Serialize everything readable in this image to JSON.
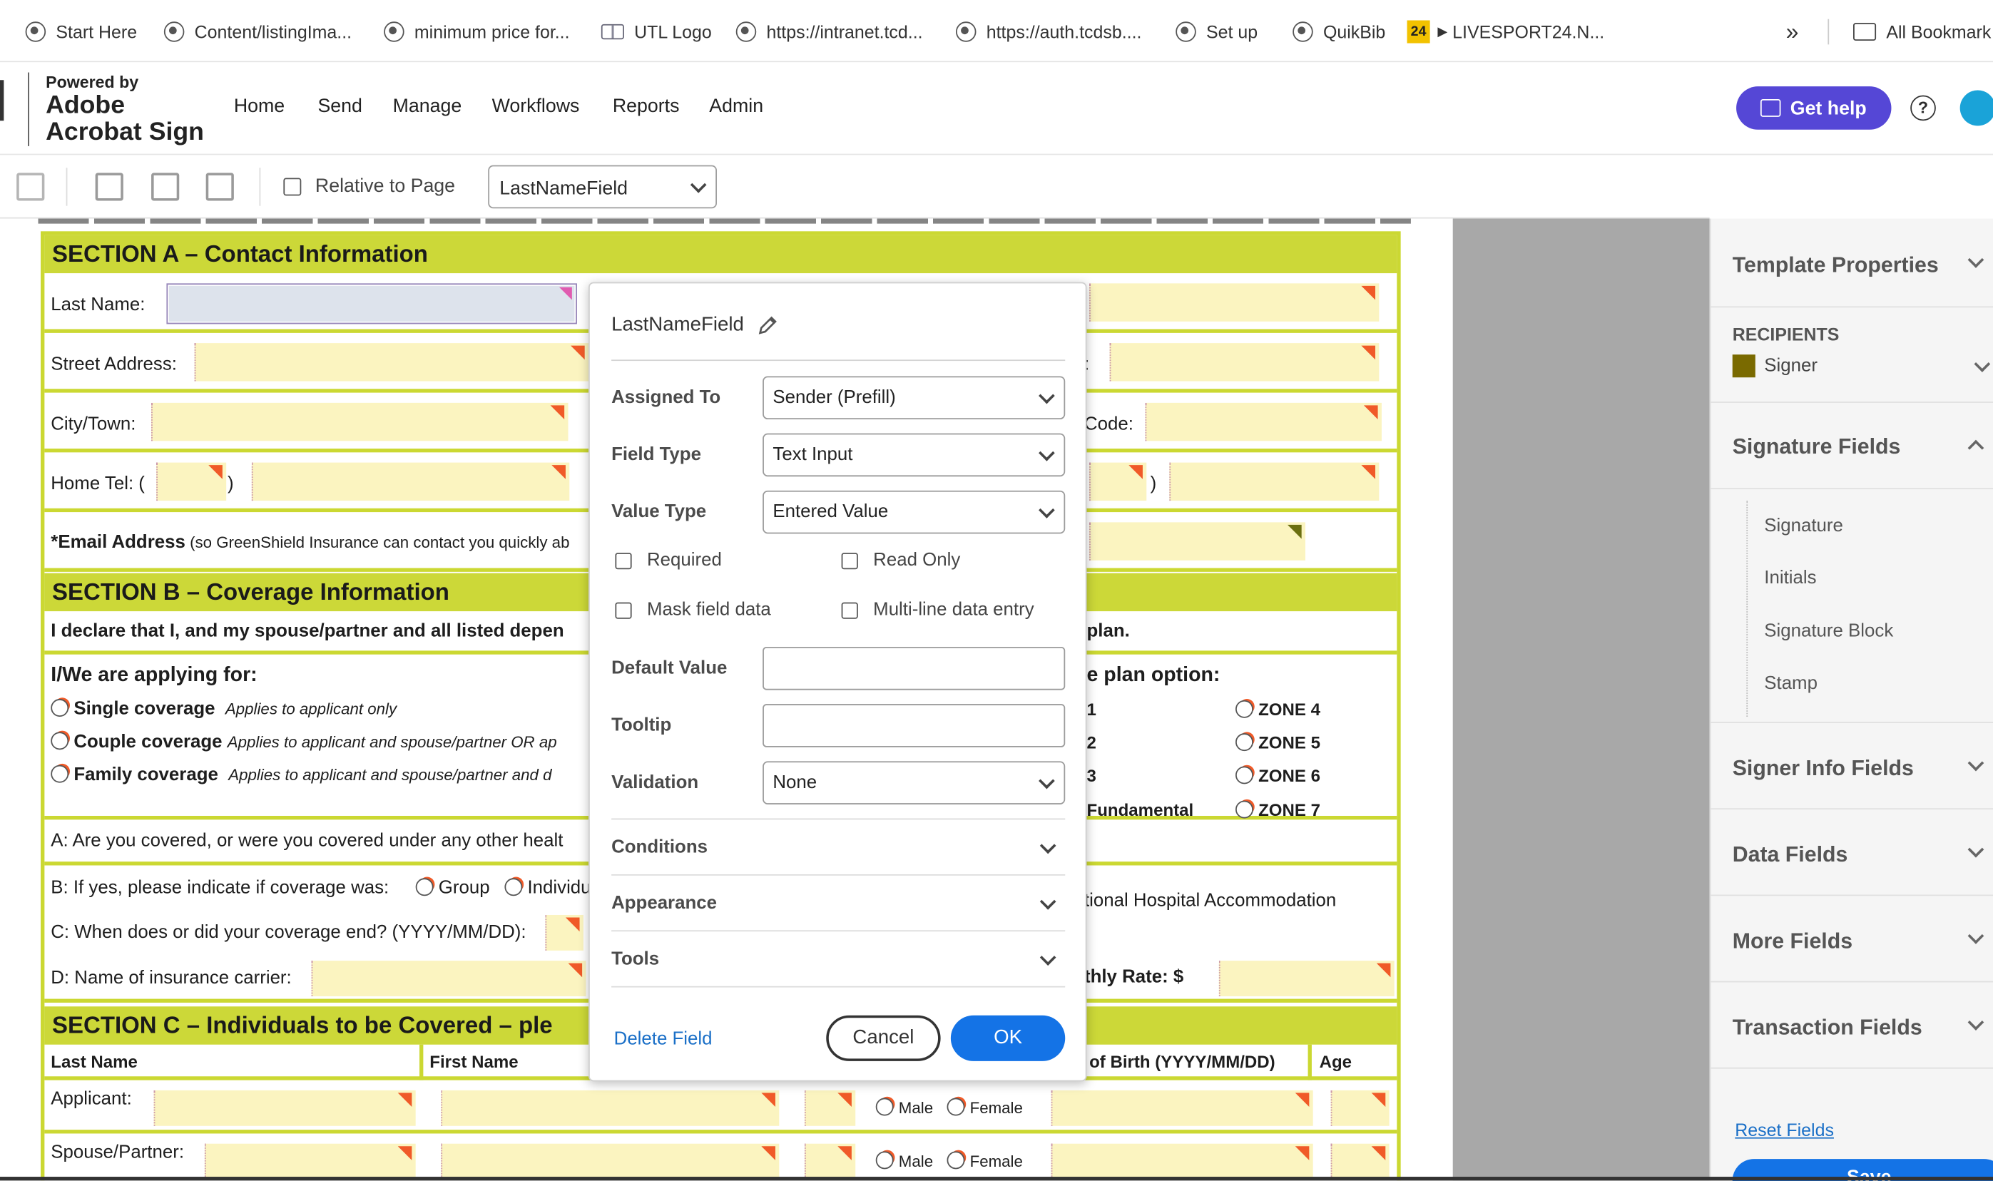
{
  "bookmarks": {
    "items": [
      {
        "label": "Start Here"
      },
      {
        "label": "Content/listingIma..."
      },
      {
        "label": "minimum price for..."
      },
      {
        "label": "UTL Logo"
      },
      {
        "label": "https://intranet.tcd..."
      },
      {
        "label": "https://auth.tcdsb...."
      },
      {
        "label": "Set up"
      },
      {
        "label": "QuikBib"
      },
      {
        "label": "LIVESPORT24.N..."
      }
    ],
    "livesport_badge": "24",
    "overflow": "»",
    "all_bookmarks": "All Bookmark"
  },
  "header": {
    "powered_by": "Powered by",
    "brand_line1": "Adobe",
    "brand_line2": "Acrobat Sign",
    "nav": [
      "Home",
      "Send",
      "Manage",
      "Workflows",
      "Reports",
      "Admin"
    ],
    "get_help": "Get help",
    "help_glyph": "?"
  },
  "toolbar": {
    "relative_to_page": "Relative to Page",
    "field_select": "LastNameField"
  },
  "form": {
    "section_a": "SECTION A – Contact Information",
    "last_name": "Last Name:",
    "street_address": "Street Address:",
    "city_town": "City/Town:",
    "home_tel": "Home Tel: (",
    "paren_close": ")",
    "email_label_bold": "*Email Address",
    "email_label_rest": " (so GreenShield Insurance can contact you quickly ab",
    "right_colon": ":",
    "right_code": "Code:",
    "right_paren": ")",
    "section_b": "SECTION B – Coverage Information",
    "declare": "I declare that I, and my spouse/partner and all listed depen",
    "declare_right": "plan.",
    "applying": "I/We are applying for:",
    "plan_option": "e plan option:",
    "single": "Single coverage",
    "single_note": "Applies to applicant only",
    "couple": "Couple coverage",
    "couple_note": "Applies to applicant and spouse/partner OR ap",
    "family": "Family coverage",
    "family_note": "Applies to applicant and spouse/partner and d",
    "zone_left": [
      "1",
      "2",
      "3",
      "Fundamental"
    ],
    "zones": [
      "ZONE 4",
      "ZONE 5",
      "ZONE 6",
      "ZONE 7"
    ],
    "q_a": "A:  Are you covered, or were you covered under any other healt",
    "q_b": "B:  If yes, please indicate if coverage was:",
    "q_b_group": "Group",
    "q_b_indiv": "Individu",
    "q_c": "C:  When does or did your coverage end? (YYYY/MM/DD):",
    "q_d": "D:  Name of insurance carrier:",
    "hospital": "tional Hospital Accommodation",
    "monthly": "thly Rate: $",
    "section_c": "SECTION C – Individuals to be Covered – ple",
    "col_last": "Last Name",
    "col_first": "First Name",
    "col_dob": "of Birth (YYYY/MM/DD)",
    "col_age": "Age",
    "applicant": "Applicant:",
    "spouse": "Spouse/Partner:",
    "male": "Male",
    "female": "Female"
  },
  "dialog": {
    "title": "LastNameField",
    "assigned_to_label": "Assigned To",
    "assigned_to": "Sender (Prefill)",
    "field_type_label": "Field Type",
    "field_type": "Text Input",
    "value_type_label": "Value Type",
    "value_type": "Entered Value",
    "required": "Required",
    "read_only": "Read Only",
    "mask": "Mask field data",
    "multiline": "Multi-line data entry",
    "default_value_label": "Default Value",
    "default_value": "",
    "tooltip_label": "Tooltip",
    "tooltip": "",
    "validation_label": "Validation",
    "validation": "None",
    "conditions": "Conditions",
    "appearance": "Appearance",
    "tools": "Tools",
    "delete": "Delete Field",
    "cancel": "Cancel",
    "ok": "OK"
  },
  "panel": {
    "template_properties": "Template Properties",
    "recipients": "RECIPIENTS",
    "signer": "Signer",
    "signer_color": "#7a6a00",
    "signature_fields": "Signature Fields",
    "sig_items": [
      "Signature",
      "Initials",
      "Signature Block",
      "Stamp"
    ],
    "signer_info": "Signer Info Fields",
    "data_fields": "Data Fields",
    "more_fields": "More Fields",
    "transaction_fields": "Transaction Fields",
    "reset": "Reset Fields",
    "save": "Save"
  }
}
